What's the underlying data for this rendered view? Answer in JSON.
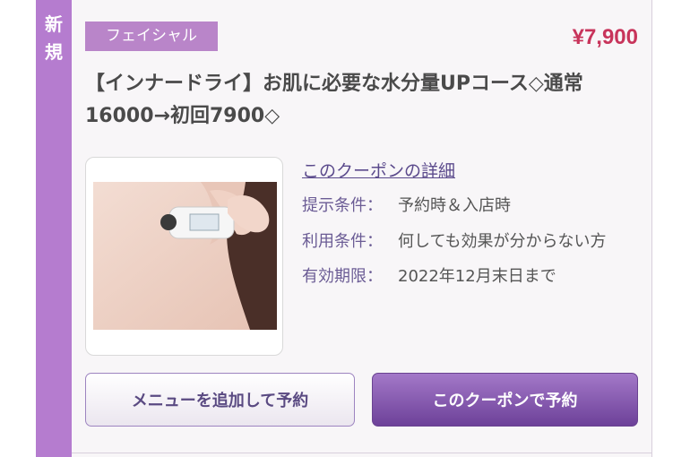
{
  "coupon": {
    "new_label": [
      "新",
      "規"
    ],
    "category_tag": "フェイシャル",
    "price": "¥7,900",
    "title_line1": "【インナードライ】お肌に必要な水分量UPコース◇通常",
    "title_line2": "16000→初回7900◇",
    "detail_link": "このクーポンの詳細",
    "conditions": [
      {
        "label": "提示条件：",
        "value": "予約時＆入店時"
      },
      {
        "label": "利用条件：",
        "value": "何しても効果が分からない方"
      },
      {
        "label": "有効期限：",
        "value": "2022年12月末日まで"
      }
    ],
    "buttons": {
      "add_menu": "メニューを追加して予約",
      "reserve": "このクーポンで予約"
    }
  },
  "colors": {
    "accent_purple": "#b57ccf",
    "price_red": "#c8345b",
    "button_purple": "#7b4fa8"
  }
}
